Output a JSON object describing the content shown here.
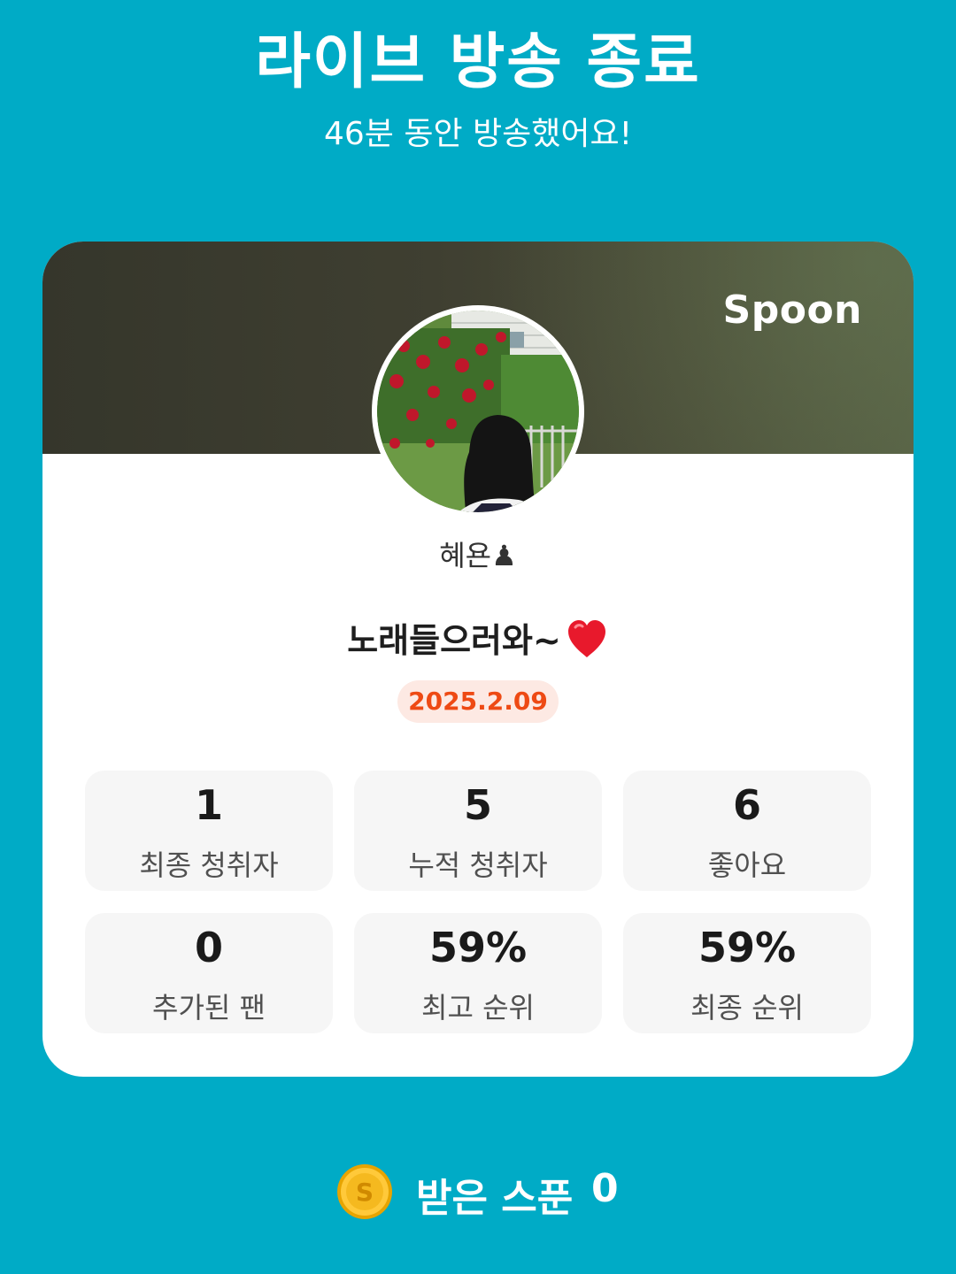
{
  "header": {
    "title": "라이브 방송 종료",
    "subtitle": "46분 동안 방송했어요!"
  },
  "card": {
    "brand": "Spoon",
    "username": "혜욘♟",
    "broadcast_title": "노래들으러와~",
    "title_emoji_icon": "heart-icon",
    "date": "2025.2.09",
    "accent_color": "#ee4a14",
    "stats": [
      {
        "value": "1",
        "label": "최종 청취자"
      },
      {
        "value": "5",
        "label": "누적 청취자"
      },
      {
        "value": "6",
        "label": "좋아요"
      },
      {
        "value": "0",
        "label": "추가된 팬"
      },
      {
        "value": "59%",
        "label": "최고 순위"
      },
      {
        "value": "59%",
        "label": "최종 순위"
      }
    ]
  },
  "footer": {
    "coin_icon": "spoon-coin-icon",
    "received_label": "받은 스푼",
    "received_value": "0"
  },
  "colors": {
    "background": "#00abc6",
    "card": "#ffffff",
    "stat_tile": "#f6f6f6",
    "date_badge_bg": "#fde9e3"
  }
}
